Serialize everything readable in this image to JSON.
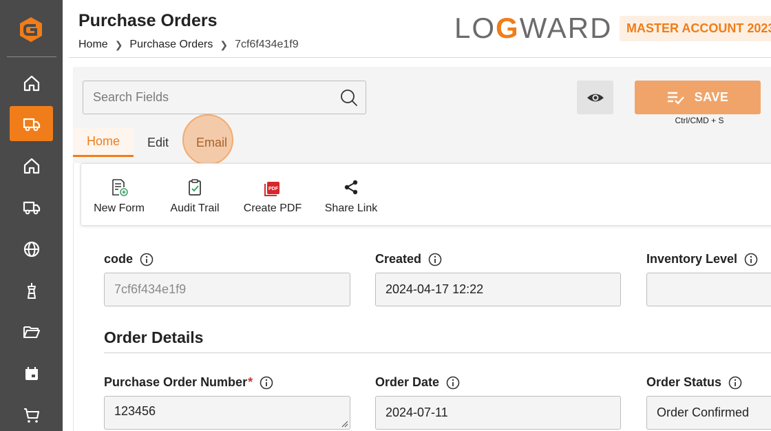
{
  "header": {
    "title": "Purchase Orders",
    "breadcrumb": [
      "Home",
      "Purchase Orders",
      "7cf6f434e1f9"
    ],
    "brand": {
      "pre": "LO",
      "mid": "G",
      "post": "WARD"
    },
    "account": "MASTER ACCOUNT 2023"
  },
  "sidebar": {
    "items": [
      {
        "icon": "home-icon"
      },
      {
        "icon": "truck-icon",
        "active": true
      },
      {
        "icon": "home-icon"
      },
      {
        "icon": "truck-icon"
      },
      {
        "icon": "globe-icon"
      },
      {
        "icon": "port-tower-icon"
      },
      {
        "icon": "folder-icon"
      },
      {
        "icon": "calendar-icon"
      },
      {
        "icon": "cart-icon"
      }
    ]
  },
  "toolbar": {
    "search_placeholder": "Search Fields",
    "save_label": "SAVE",
    "save_hint": "Ctrl/CMD + S"
  },
  "tabs": [
    {
      "label": "Home",
      "active": true
    },
    {
      "label": "Edit"
    },
    {
      "label": "Email",
      "highlighted": true
    }
  ],
  "actions": [
    {
      "label": "New Form",
      "icon": "new-form-icon"
    },
    {
      "label": "Audit Trail",
      "icon": "clipboard-check-icon"
    },
    {
      "label": "Create PDF",
      "icon": "pdf-icon"
    },
    {
      "label": "Share Link",
      "icon": "share-icon"
    }
  ],
  "fields": {
    "code": {
      "label": "code",
      "value": "7cf6f434e1f9"
    },
    "created": {
      "label": "Created",
      "value": "2024-04-17 12:22"
    },
    "inventory": {
      "label": "Inventory Level",
      "value": ""
    },
    "section": "Order Details",
    "po_number": {
      "label": "Purchase Order Number",
      "required_mark": "*",
      "value": "123456"
    },
    "order_date": {
      "label": "Order Date",
      "value": "2024-07-11"
    },
    "order_status": {
      "label": "Order Status",
      "value": "Order Confirmed"
    }
  },
  "colors": {
    "accent": "#f07d19",
    "sidebar": "#4a4a4a",
    "save": "#f0a46a",
    "required": "#d32f2f"
  }
}
